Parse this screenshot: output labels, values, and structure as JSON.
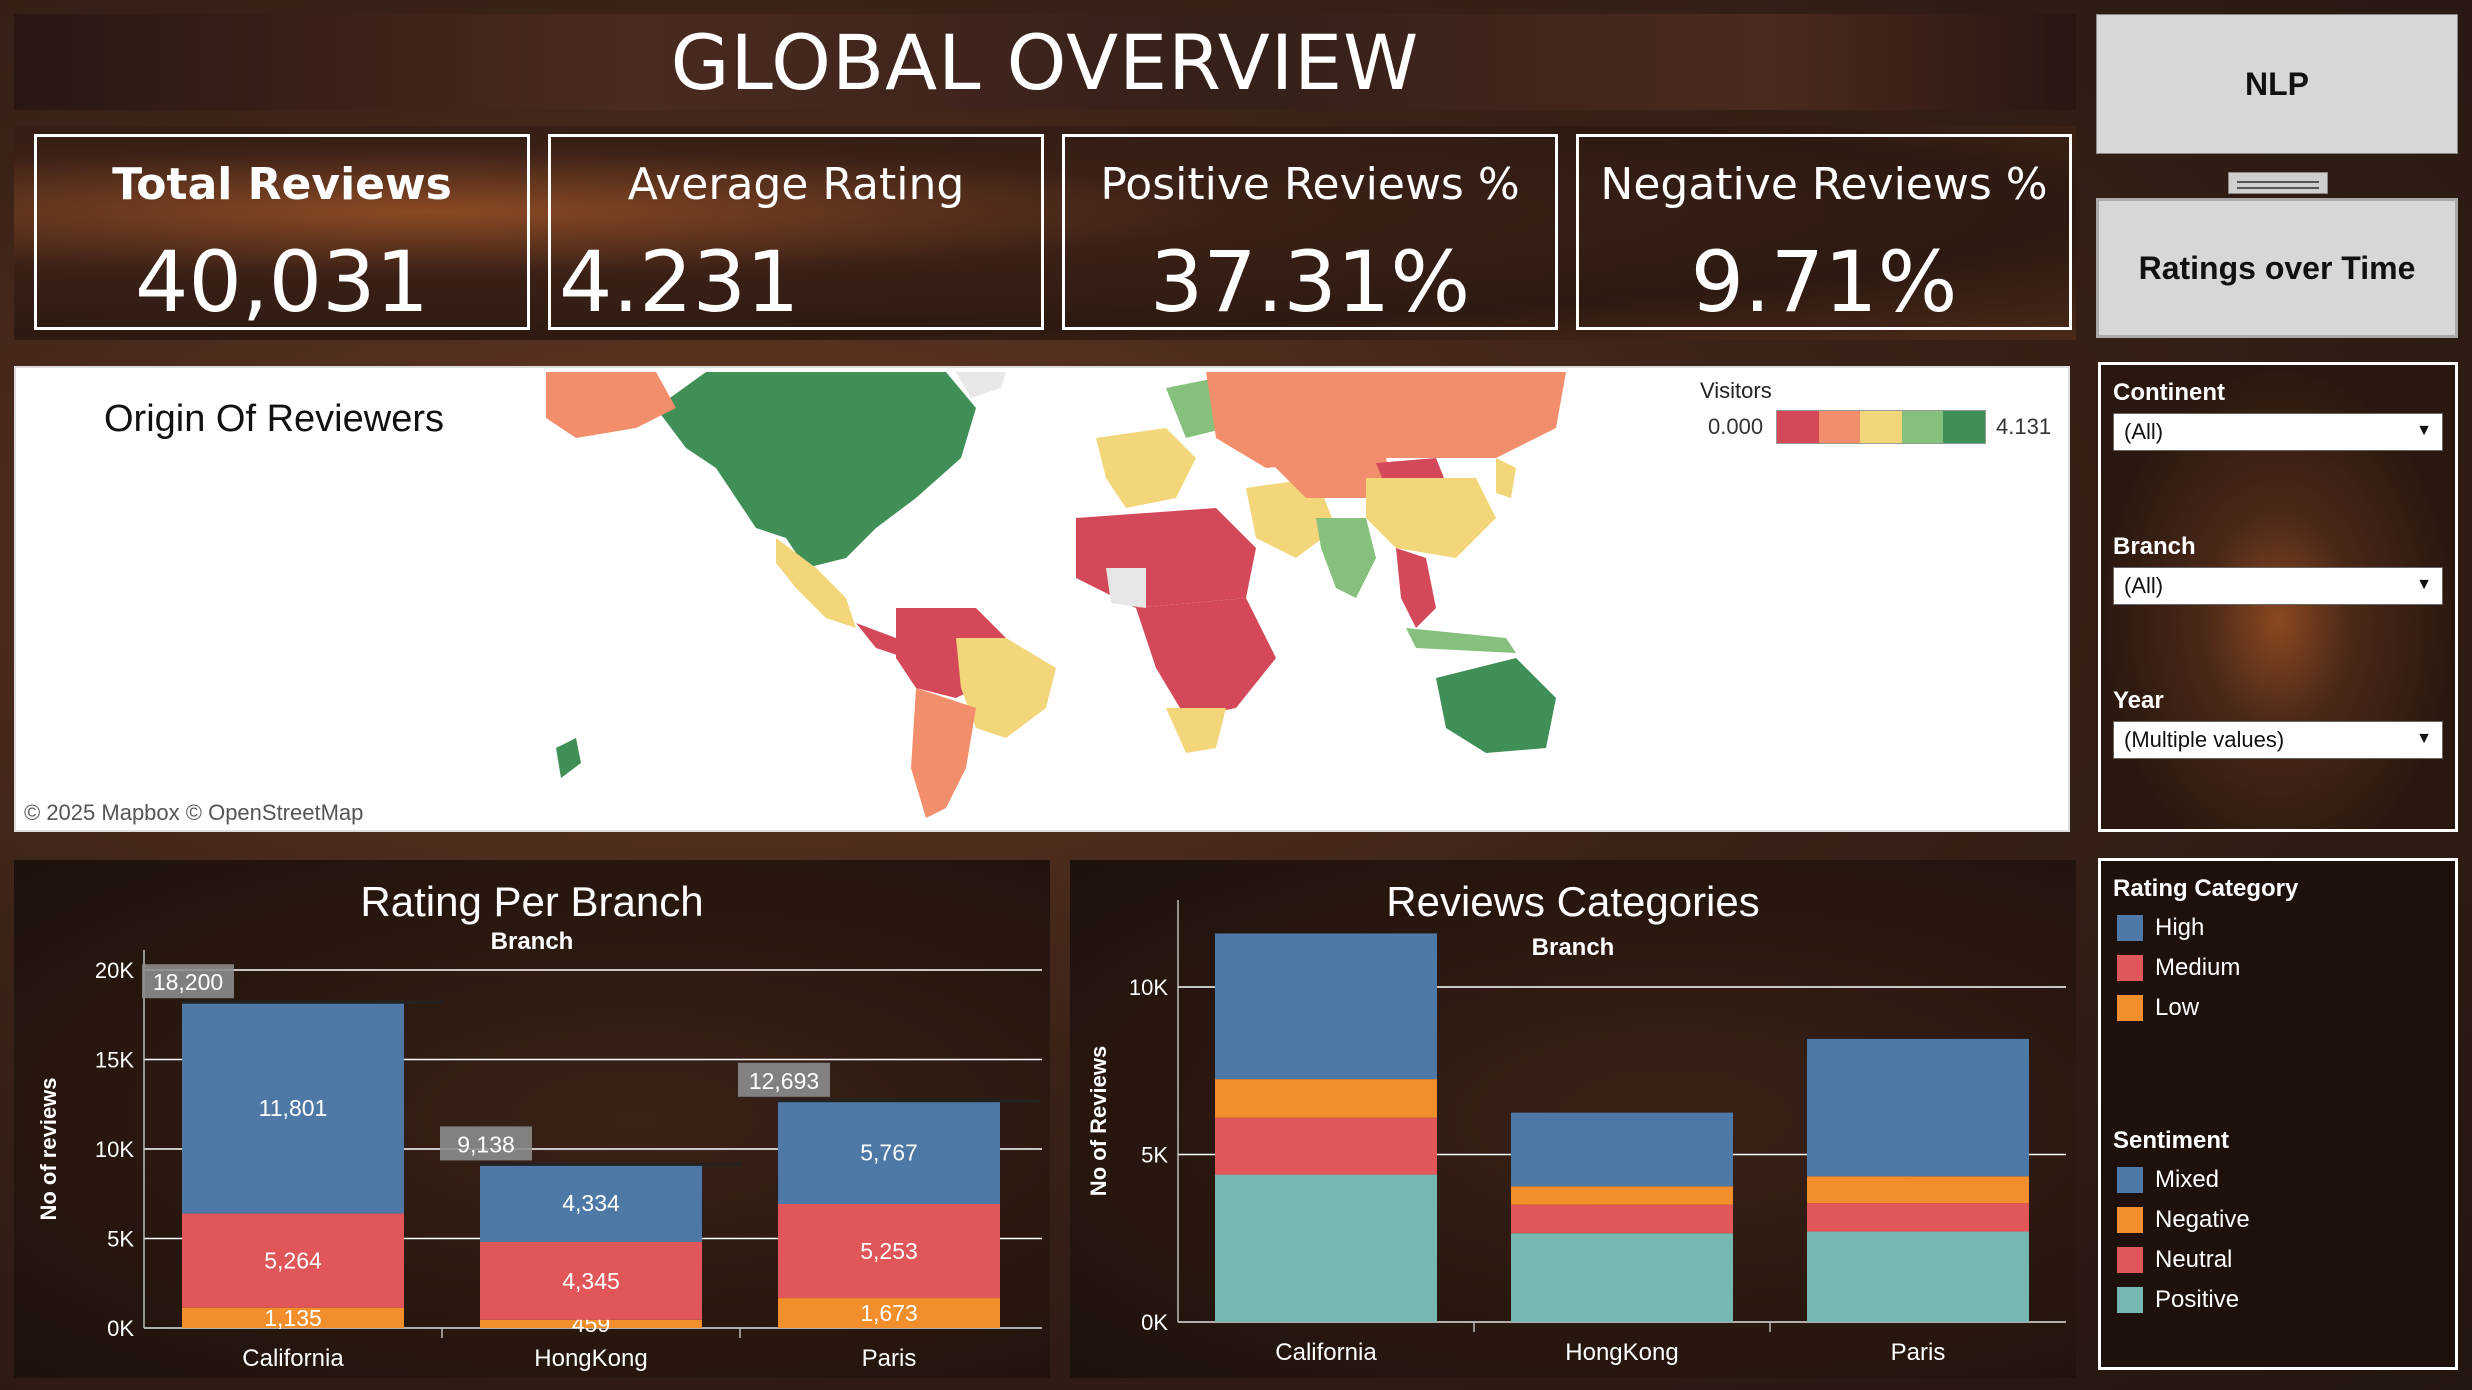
{
  "title": "GLOBAL OVERVIEW",
  "kpis": [
    {
      "label": "Total Reviews",
      "value": "40,031"
    },
    {
      "label": "Average Rating",
      "value": "4.231"
    },
    {
      "label": "Positive Reviews %",
      "value": "37.31%"
    },
    {
      "label": "Negative Reviews %",
      "value": "9.71%"
    }
  ],
  "map": {
    "title": "Origin Of Reviewers",
    "credit": "© 2025 Mapbox  © OpenStreetMap",
    "legend_title": "Visitors",
    "legend_min": "0.000",
    "legend_max": "4.131",
    "ramp_colors": [
      "#d4495a",
      "#f28e6b",
      "#f3d57a",
      "#86c07d",
      "#3f8f57"
    ]
  },
  "nav": {
    "nlp": "NLP",
    "ratings_over_time": "Ratings over Time"
  },
  "filters": {
    "continent_label": "Continent",
    "continent_value": "(All)",
    "branch_label": "Branch",
    "branch_value": "(All)",
    "year_label": "Year",
    "year_value": "(Multiple values)"
  },
  "legends": {
    "rating_title": "Rating Category",
    "rating_items": [
      {
        "label": "High",
        "color": "#4e79a7"
      },
      {
        "label": "Medium",
        "color": "#e15759"
      },
      {
        "label": "Low",
        "color": "#f28e2b"
      }
    ],
    "sentiment_title": "Sentiment",
    "sentiment_items": [
      {
        "label": "Mixed",
        "color": "#4e79a7"
      },
      {
        "label": "Negative",
        "color": "#f28e2b"
      },
      {
        "label": "Neutral",
        "color": "#e15759"
      },
      {
        "label": "Positive",
        "color": "#76b7b2"
      }
    ]
  },
  "chart_data": [
    {
      "type": "bar",
      "stacked": true,
      "title": "Rating Per Branch",
      "subtitle": "Branch",
      "ylabel": "No of reviews",
      "ylim": [
        0,
        20000
      ],
      "yticks": [
        "0K",
        "5K",
        "10K",
        "15K",
        "20K"
      ],
      "categories": [
        "California",
        "HongKong",
        "Paris"
      ],
      "totals": [
        "18,200",
        "9,138",
        "12,693"
      ],
      "series": [
        {
          "name": "Low",
          "color": "#f28e2b",
          "values": [
            1135,
            459,
            1673
          ],
          "labels": [
            "1,135",
            "459",
            "1,673"
          ]
        },
        {
          "name": "Medium",
          "color": "#e15759",
          "values": [
            5264,
            4345,
            5253
          ],
          "labels": [
            "5,264",
            "4,345",
            "5,253"
          ]
        },
        {
          "name": "High",
          "color": "#4e79a7",
          "values": [
            11801,
            4334,
            5767
          ],
          "labels": [
            "11,801",
            "4,334",
            "5,767"
          ]
        }
      ]
    },
    {
      "type": "bar",
      "stacked": true,
      "title": "Reviews Categories",
      "subtitle": "Branch",
      "ylabel": "No of Reviews",
      "ylim": [
        0,
        12000
      ],
      "yticks": [
        "0K",
        "5K",
        "10K"
      ],
      "categories": [
        "California",
        "HongKong",
        "Paris"
      ],
      "series": [
        {
          "name": "Positive",
          "color": "#76b7b2",
          "values": [
            4400,
            2650,
            2700
          ]
        },
        {
          "name": "Neutral",
          "color": "#e15759",
          "values": [
            1700,
            850,
            850
          ]
        },
        {
          "name": "Negative",
          "color": "#f28e2b",
          "values": [
            1150,
            550,
            800
          ]
        },
        {
          "name": "Mixed",
          "color": "#4e79a7",
          "values": [
            4350,
            2200,
            4100
          ]
        }
      ]
    }
  ]
}
